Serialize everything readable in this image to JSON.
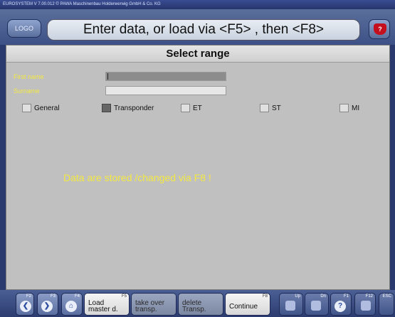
{
  "window": {
    "title": "EUROSYSTEM V 7.00.012   © PAWA Maschinenbau Holderwerwig GmbH & Co. KG"
  },
  "header": {
    "logo_label": "LOGO",
    "instruction": "Enter data, or load via <F5> , then <F8>",
    "help_icon_text": "?"
  },
  "panel": {
    "title": "Select range",
    "first_name_label": "First name",
    "surname_label": "Surname",
    "checkboxes": [
      {
        "label": "General",
        "checked": false
      },
      {
        "label": "Transponder",
        "checked": true
      },
      {
        "label": "ET",
        "checked": false
      },
      {
        "label": "ST",
        "checked": false
      },
      {
        "label": "MI",
        "checked": false
      }
    ],
    "message": "Data are stored /changed via F8  !"
  },
  "fkeys": {
    "f2": {
      "key": "F2",
      "icon": "arrow-left-icon"
    },
    "f3": {
      "key": "F3",
      "icon": "arrow-right-icon"
    },
    "f4": {
      "key": "F4",
      "icon": "home-icon"
    },
    "f5": {
      "key": "F5",
      "label_line1": "Load",
      "label_line2": "master d."
    },
    "f6": {
      "key": "",
      "label_line1": "take over",
      "label_line2": "transp."
    },
    "f7": {
      "key": "",
      "label_line1": "delete",
      "label_line2": "Transp."
    },
    "f8": {
      "key": "F8",
      "label": "Continue"
    },
    "up": {
      "key": "Up"
    },
    "dn": {
      "key": "Dn"
    },
    "f1": {
      "key": "F1",
      "icon": "help-icon"
    },
    "f12": {
      "key": "F12"
    },
    "esc": {
      "key": "ESC"
    }
  },
  "colors": {
    "accent_yellow": "#f3e842",
    "panel_bg": "#c0c0c0",
    "frame_blue": "#3d5187"
  }
}
